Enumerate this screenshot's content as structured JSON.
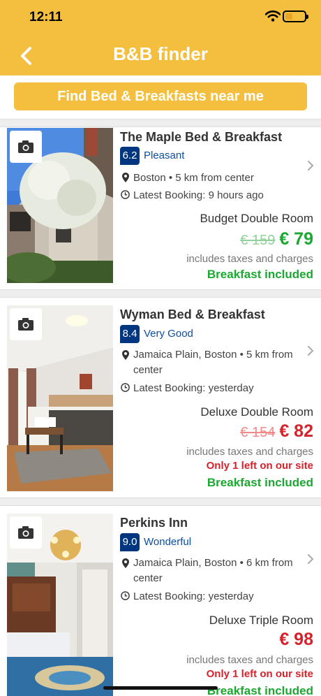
{
  "status": {
    "time": "12:11"
  },
  "header": {
    "title": "B&B finder",
    "back_icon": "chevron-left-icon"
  },
  "find_button": {
    "label": "Find Bed & Breakfasts near me"
  },
  "colors": {
    "brand": "#f4bf3e",
    "score_badge": "#003580",
    "price_green": "#1aa830",
    "price_red": "#d6222b"
  },
  "listings": [
    {
      "name": "The Maple Bed & Breakfast",
      "score": "6.2",
      "score_label": "Pleasant",
      "location": "Boston • 5 km from center",
      "latest_booking": "Latest Booking: 9 hours ago",
      "room": "Budget Double Room",
      "old_price": "€ 159",
      "price": "€ 79",
      "taxes": "includes taxes and charges",
      "availability": "",
      "breakfast": "Breakfast included"
    },
    {
      "name": "Wyman Bed & Breakfast",
      "score": "8.4",
      "score_label": "Very Good",
      "location": "Jamaica Plain, Boston • 5 km from center",
      "latest_booking": "Latest Booking: yesterday",
      "room": "Deluxe Double Room",
      "old_price": "€ 154",
      "price": "€ 82",
      "taxes": "includes taxes and charges",
      "availability": "Only 1 left on our site",
      "breakfast": "Breakfast included"
    },
    {
      "name": "Perkins Inn",
      "score": "9.0",
      "score_label": "Wonderful",
      "location": "Jamaica Plain, Boston • 6 km from center",
      "latest_booking": "Latest Booking: yesterday",
      "room": "Deluxe Triple Room",
      "old_price": "",
      "price": "€ 98",
      "taxes": "includes taxes and charges",
      "availability": "Only 1 left on our site",
      "breakfast": "Breakfast included"
    }
  ]
}
